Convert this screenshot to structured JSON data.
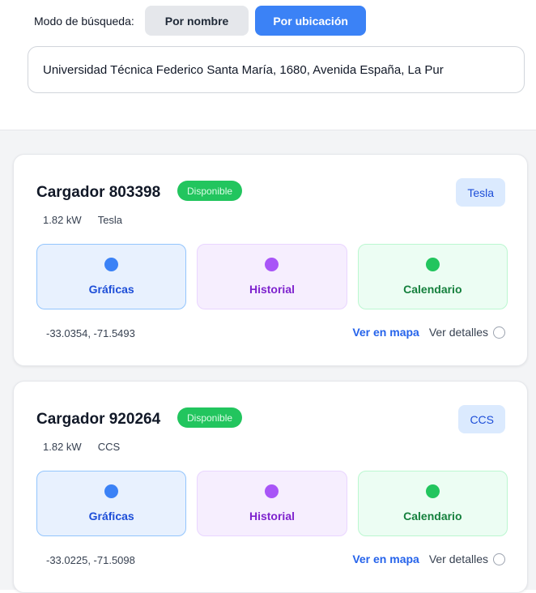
{
  "search_mode": {
    "label": "Modo de búsqueda:",
    "options": [
      "Por nombre",
      "Por ubicación"
    ],
    "selected": "Por ubicación"
  },
  "search": {
    "value": "Universidad Técnica Federico Santa María, 1680, Avenida España, La Pur"
  },
  "chargers": [
    {
      "title": "Cargador 803398",
      "status": "Disponible",
      "connector_tag": "Tesla",
      "power": "1.82 kW",
      "connector": "Tesla",
      "actions": [
        "Gráficas",
        "Historial",
        "Calendario"
      ],
      "coords": "-33.0354, -71.5493",
      "map_link": "Ver en mapa",
      "details_label": "Ver detalles",
      "details_checked": false
    },
    {
      "title": "Cargador 920264",
      "status": "Disponible",
      "connector_tag": "CCS",
      "power": "1.82 kW",
      "connector": "CCS",
      "actions": [
        "Gráficas",
        "Historial",
        "Calendario"
      ],
      "coords": "-33.0225, -71.5098",
      "map_link": "Ver en mapa",
      "details_label": "Ver detalles",
      "details_checked": false
    }
  ],
  "colors": {
    "accent": "#3b82f6",
    "available": "#22c55e",
    "history": "#a855f7"
  }
}
